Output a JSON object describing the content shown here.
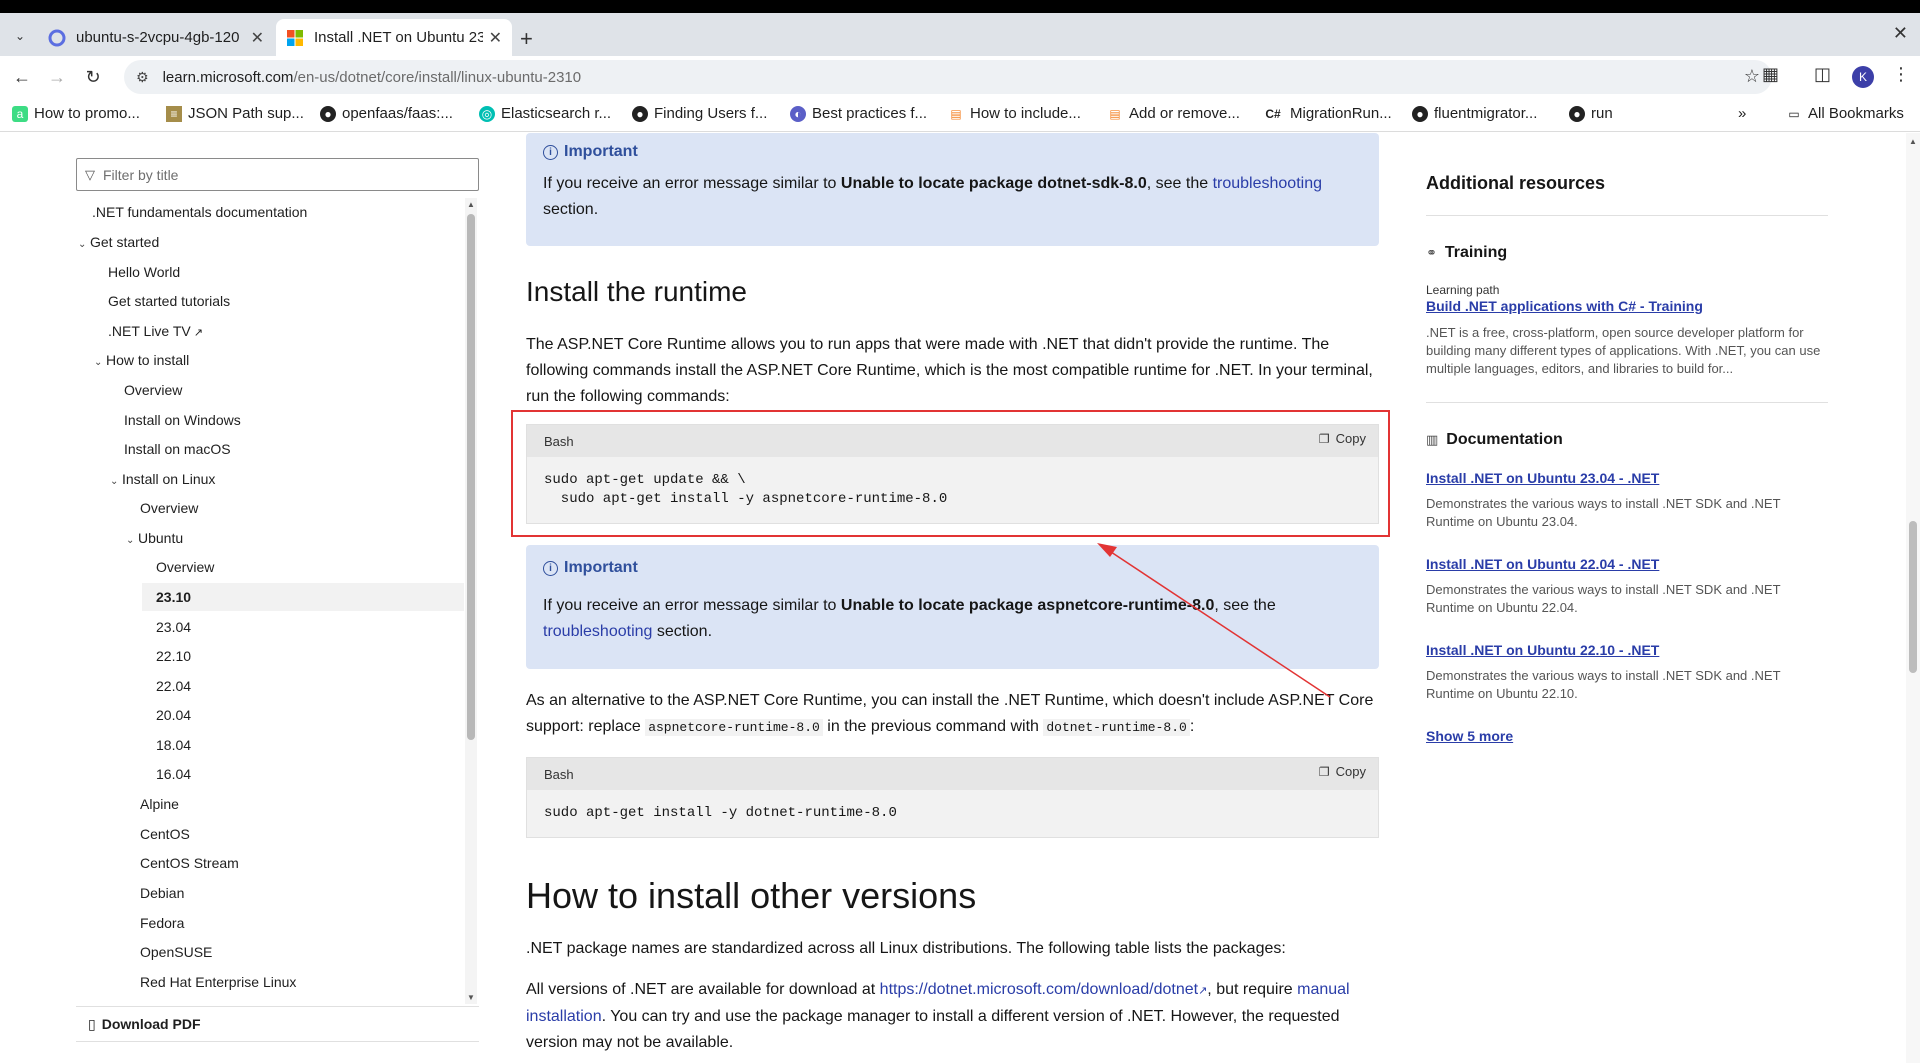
{
  "browser": {
    "tabs": [
      {
        "title": "ubuntu-s-2vcpu-4gb-120",
        "active": false
      },
      {
        "title": "Install .NET on Ubuntu 23",
        "active": true
      }
    ],
    "url_host": "learn.microsoft.com",
    "url_path": "/en-us/dotnet/core/install/linux-ubuntu-2310",
    "profile_initial": "K",
    "bookmarks": [
      "How to promo...",
      "JSON Path sup...",
      "openfaas/faas:...",
      "Elasticsearch r...",
      "Finding Users f...",
      "Best practices f...",
      "How to include...",
      "Add or remove...",
      "MigrationRun...",
      "fluentmigrator...",
      "run"
    ],
    "all_bookmarks": "All Bookmarks"
  },
  "toc": {
    "filter_placeholder": "Filter by title",
    "items": [
      ".NET fundamentals documentation",
      "Get started",
      "Hello World",
      "Get started tutorials",
      ".NET Live TV",
      "How to install",
      "Overview",
      "Install on Windows",
      "Install on macOS",
      "Install on Linux",
      "Overview",
      "Ubuntu",
      "Overview",
      "23.10",
      "23.04",
      "22.10",
      "22.04",
      "20.04",
      "18.04",
      "16.04",
      "Alpine",
      "CentOS",
      "CentOS Stream",
      "Debian",
      "Fedora",
      "OpenSUSE",
      "Red Hat Enterprise Linux"
    ],
    "download_pdf": "Download PDF"
  },
  "main": {
    "alert1": {
      "heading": "Important",
      "pre": "If you receive an error message similar to ",
      "bold": "Unable to locate package dotnet-sdk-8.0",
      "mid": ", see the ",
      "link": "troubleshooting",
      "post": "section."
    },
    "runtime_heading": "Install the runtime",
    "runtime_para": "The ASP.NET Core Runtime allows you to run apps that were made with .NET that didn't provide the runtime. The following commands install the ASP.NET Core Runtime, which is the most compatible runtime for .NET. In your terminal, run the following commands:",
    "code1": {
      "lang": "Bash",
      "copy": "Copy",
      "text": "sudo apt-get update && \\\n  sudo apt-get install -y aspnetcore-runtime-8.0"
    },
    "alert2": {
      "heading": "Important",
      "pre": "If you receive an error message similar to ",
      "bold": "Unable to locate package aspnetcore-runtime-8.0",
      "mid": ", see the",
      "link": "troubleshooting",
      "post": " section."
    },
    "alt_para": {
      "pre": "As an alternative to the ASP.NET Core Runtime, you can install the .NET Runtime, which doesn't include ASP.NET Core support: replace ",
      "code_a": "aspnetcore-runtime-8.0",
      "mid": " in the previous command with ",
      "code_b": "dotnet-runtime-8.0",
      "post": ":"
    },
    "code2": {
      "lang": "Bash",
      "copy": "Copy",
      "text": "sudo apt-get install -y dotnet-runtime-8.0"
    },
    "other_heading": "How to install other versions",
    "other_para": ".NET package names are standardized across all Linux distributions. The following table lists the packages:",
    "versions_para": {
      "pre": "All versions of .NET are available for download at ",
      "link1": "https://dotnet.microsoft.com/download/dotnet",
      "mid": ", but require ",
      "link2": "manual installation",
      "post": ". You can try and use the package manager to install a different version of .NET. However, the requested version may not be available."
    }
  },
  "rail": {
    "heading": "Additional resources",
    "training": {
      "title": "Training",
      "kind": "Learning path",
      "link": "Build .NET applications with C# - Training",
      "desc": ".NET is a free, cross-platform, open source developer platform for building many different types of applications. With .NET, you can use multiple languages, editors, and libraries to build for..."
    },
    "documentation": {
      "title": "Documentation",
      "items": [
        {
          "link": "Install .NET on Ubuntu 23.04 - .NET",
          "desc": "Demonstrates the various ways to install .NET SDK and .NET Runtime on Ubuntu 23.04."
        },
        {
          "link": "Install .NET on Ubuntu 22.04 - .NET",
          "desc": "Demonstrates the various ways to install .NET SDK and .NET Runtime on Ubuntu 22.04."
        },
        {
          "link": "Install .NET on Ubuntu 22.10 - .NET",
          "desc": "Demonstrates the various ways to install .NET SDK and .NET Runtime on Ubuntu 22.10."
        }
      ],
      "show_more": "Show 5 more"
    }
  },
  "colors": {
    "accent_link": "#2a3da8",
    "alert_bg": "#dbe4f5",
    "annotation_red": "#e23434"
  }
}
